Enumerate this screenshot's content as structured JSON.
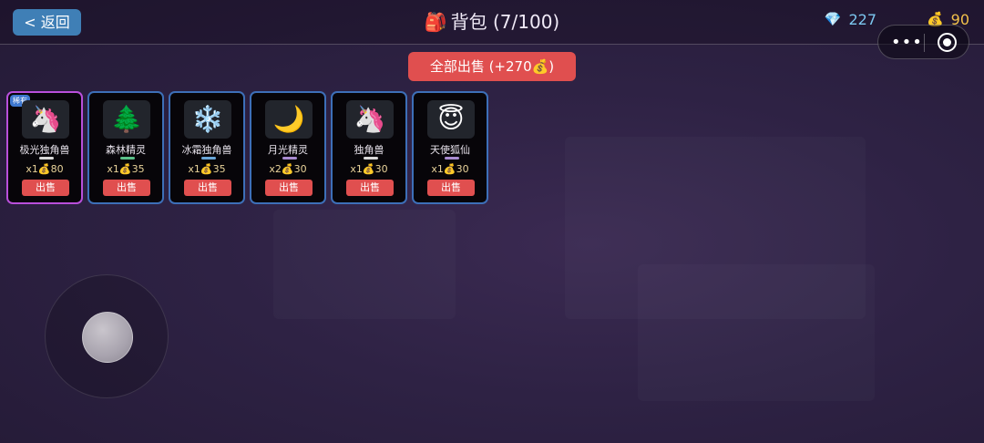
{
  "header": {
    "back_label": "< 返回",
    "bag_icon": "🎒",
    "title": "背包 (7/100)",
    "gem_icon": "💎",
    "gems": "227",
    "gold_icon": "💰",
    "gold": "90"
  },
  "capsule": {
    "more": "•••"
  },
  "sell_all_label": "全部出售 (+270💰)",
  "items": [
    {
      "icon": "🦄",
      "name": "极光独角兽",
      "qty": "x1",
      "price": "💰80",
      "sell": "出售",
      "tag": "稀有",
      "bar_color": "#d9d9d9"
    },
    {
      "icon": "🌲",
      "name": "森林精灵",
      "qty": "x1",
      "price": "💰35",
      "sell": "出售",
      "tag": "",
      "bar_color": "#5bc28a"
    },
    {
      "icon": "❄️",
      "name": "冰霜独角兽",
      "qty": "x1",
      "price": "💰35",
      "sell": "出售",
      "tag": "",
      "bar_color": "#6aa6d8"
    },
    {
      "icon": "🌙",
      "name": "月光精灵",
      "qty": "x2",
      "price": "💰30",
      "sell": "出售",
      "tag": "",
      "bar_color": "#a88bd0"
    },
    {
      "icon": "🦄",
      "name": "独角兽",
      "qty": "x1",
      "price": "💰30",
      "sell": "出售",
      "tag": "",
      "bar_color": "#d9d9d9"
    },
    {
      "icon": "😇",
      "name": "天使狐仙",
      "qty": "x1",
      "price": "💰30",
      "sell": "出售",
      "tag": "",
      "bar_color": "#a88bd0"
    }
  ]
}
